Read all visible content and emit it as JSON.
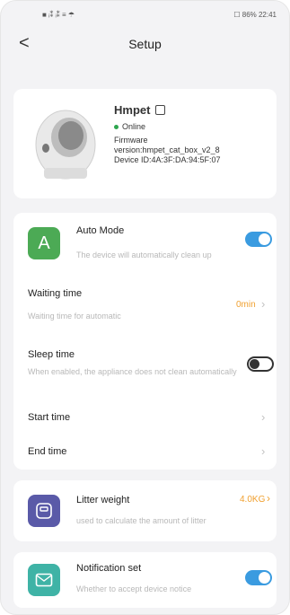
{
  "status_bar": {
    "left_text": "■ ᵢ⁑ ᵢ⁑ ≡ ☂",
    "right_text": "☐ 86%  22:41"
  },
  "nav": {
    "back_label": "<",
    "title": "Setup"
  },
  "device": {
    "name": "Hmpet",
    "status": "Online",
    "firmware_label": "Firmware",
    "firmware_version": "version:hmpet_cat_box_v2_8",
    "device_id": "Device ID:4A:3F:DA:94:5F:07"
  },
  "auto_mode": {
    "icon_letter": "A",
    "title": "Auto Mode",
    "subtitle": "The device will automatically clean up",
    "enabled": true,
    "icon_color": "#4caa55"
  },
  "waiting_time": {
    "title": "Waiting time",
    "subtitle": "Waiting time for automatic",
    "value": "0min"
  },
  "sleep_time": {
    "title": "Sleep time",
    "subtitle": "When enabled, the appliance does not clean automatically",
    "enabled": false
  },
  "start_time": {
    "title": "Start time"
  },
  "end_time": {
    "title": "End time"
  },
  "litter_weight": {
    "title": "Litter weight",
    "subtitle": "used to calculate the amount of litter",
    "value": "4.0KG",
    "icon_color": "#5a5aa8"
  },
  "notification": {
    "title": "Notification set",
    "subtitle": "Whether to accept device notice",
    "enabled": true,
    "icon_color": "#3fb3a6"
  },
  "colors": {
    "accent_blue": "#3a9be0",
    "value_orange": "#f0a030"
  }
}
